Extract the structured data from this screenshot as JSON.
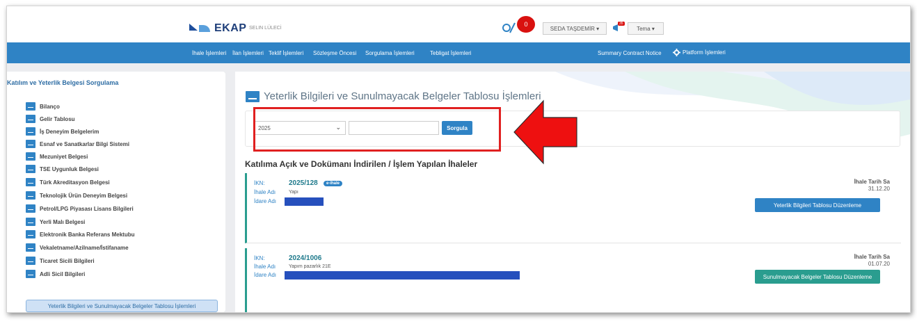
{
  "header": {
    "logo_text": "EKAP",
    "logo_subtitle": "SELIN LÜLECİ",
    "notification_count": "0",
    "user_menu": "SEDA TAŞDEMİR ▾",
    "announcement_badge": "35",
    "theme_menu": "Tema ▾"
  },
  "nav": {
    "items": [
      "İhale İşlemleri",
      "İlan İşlemleri",
      "Teklif İşlemleri",
      "Sözleşme Öncesi",
      "Sorgulama İşlemleri",
      "Tebligat İşlemleri"
    ],
    "summary": "Summary Contract Notice",
    "platform": "Platform İşlemleri"
  },
  "sidebar": {
    "title": "Katılım ve Yeterlik Belgesi Sorgulama",
    "items": [
      "Bilanço",
      "Gelir Tablosu",
      "İş Deneyim Belgelerim",
      "Esnaf ve Sanatkarlar Bilgi Sistemi",
      "Mezuniyet Belgesi",
      "TSE Uygunluk Belgesi",
      "Türk Akreditasyon Belgesi",
      "Teknolojik Ürün Deneyim Belgesi",
      "Petrol/LPG Piyasası Lisans Bilgileri",
      "Yerli Malı Belgesi",
      "Elektronik Banka Referans Mektubu",
      "Vekaletname/Azilname/İstifaname",
      "Ticaret Sicili Bilgileri",
      "Adli Sicil Bilgileri"
    ],
    "active_item": "Yeterlik Bilgileri ve Sunulmayacak Belgeler Tablosu İşlemleri"
  },
  "main": {
    "title": "Yeterlik Bilgileri ve Sunulmayacak Belgeler Tablosu İşlemleri",
    "filter": {
      "year_value": "2025",
      "ikn_placeholder": "",
      "search_button": "Sorgula"
    },
    "section_heading": "Katılıma Açık ve Dokümanı İndirilen / İşlem Yapılan İhaleler",
    "labels": {
      "ikn": "İKN:",
      "ihale_adi": "İhale Adı",
      "idare_adi": "İdare Adı",
      "ihale_tarih": "İhale Tarih Sa"
    },
    "tenders": [
      {
        "ikn": "2025/128",
        "badge": "e-ihale",
        "ihale_adi": "Yapı",
        "date": "31.12.20",
        "action": "Yeterlik Bilgileri Tablosu Düzenleme"
      },
      {
        "ikn": "2024/1006",
        "badge": "",
        "ihale_adi": "Yapım pazarlık 21E",
        "date": "01.07.20",
        "action": "Sunulmayacak Belgeler Tablosu Düzenleme"
      }
    ]
  },
  "colors": {
    "nav_blue": "#2f83c5",
    "highlight_red": "#e02020",
    "teal": "#2a9d8f",
    "redaction_blue": "#2650bd"
  }
}
